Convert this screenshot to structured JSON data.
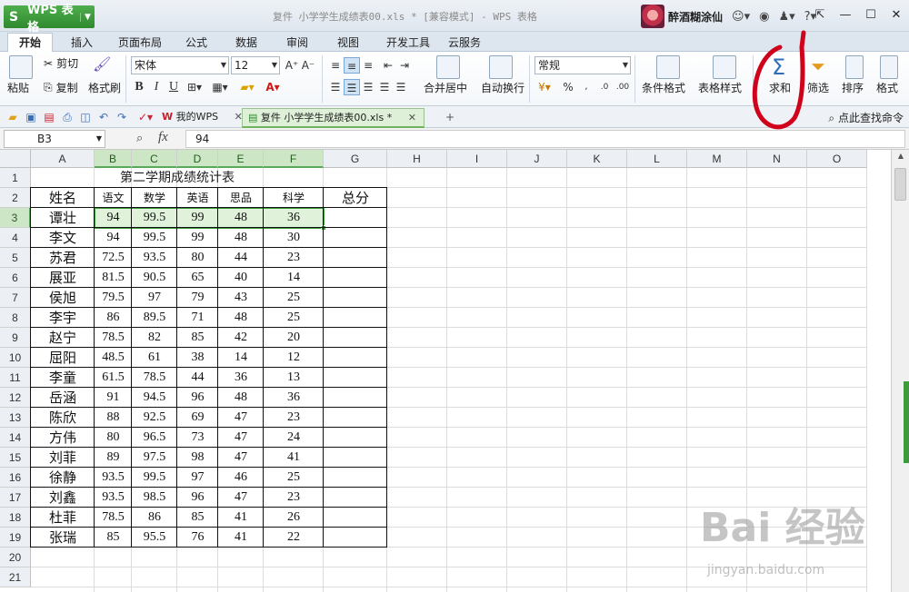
{
  "app": {
    "logo_glyph": "S",
    "name": "WPS 表格",
    "doc_title": "复件 小学学生成绩表00.xls * [兼容模式] - WPS 表格",
    "user_name": "醉酒糊涂仙",
    "window_controls": [
      "⇱",
      "—",
      "☐",
      "✕"
    ]
  },
  "menu": {
    "tabs": [
      "开始",
      "插入",
      "页面布局",
      "公式",
      "数据",
      "审阅",
      "视图",
      "开发工具",
      "云服务"
    ],
    "active": "开始"
  },
  "ribbon": {
    "paste": "粘贴",
    "cut": "剪切",
    "copy": "复制",
    "format_painter": "格式刷",
    "font_name": "宋体",
    "font_size": "12",
    "merge_center": "合并居中",
    "auto_wrap": "自动换行",
    "number_format": "常规",
    "conditional_format": "条件格式",
    "table_style": "表格样式",
    "sum": "求和",
    "filter": "筛选",
    "sort": "排序",
    "format": "格式"
  },
  "filebar": {
    "tabs": [
      {
        "label": "我的WPS"
      },
      {
        "label": "复件 小学学生成绩表00.xls *"
      }
    ],
    "search_command": "点此查找命令"
  },
  "formula": {
    "cell_ref": "B3",
    "fx": "fx",
    "value": "94"
  },
  "sheet": {
    "columns": [
      "A",
      "B",
      "C",
      "D",
      "E",
      "F",
      "G",
      "H",
      "I",
      "J",
      "K",
      "L",
      "M",
      "N",
      "O"
    ],
    "rows": [
      "1",
      "2",
      "3",
      "4",
      "5",
      "6",
      "7",
      "8",
      "9",
      "10",
      "11",
      "12",
      "13",
      "14",
      "15",
      "16",
      "17",
      "18",
      "19",
      "20",
      "21"
    ],
    "title": "第二学期成绩统计表",
    "headers": [
      "姓名",
      "语文",
      "数学",
      "英语",
      "思品",
      "科学",
      "总分"
    ],
    "data": [
      [
        "谭壮",
        "94",
        "99.5",
        "99",
        "48",
        "36"
      ],
      [
        "李文",
        "94",
        "99.5",
        "99",
        "48",
        "30"
      ],
      [
        "苏君",
        "72.5",
        "93.5",
        "80",
        "44",
        "23"
      ],
      [
        "展亚",
        "81.5",
        "90.5",
        "65",
        "40",
        "14"
      ],
      [
        "侯旭",
        "79.5",
        "97",
        "79",
        "43",
        "25"
      ],
      [
        "李宇",
        "86",
        "89.5",
        "71",
        "48",
        "25"
      ],
      [
        "赵宁",
        "78.5",
        "82",
        "85",
        "42",
        "20"
      ],
      [
        "屈阳",
        "48.5",
        "61",
        "38",
        "14",
        "12"
      ],
      [
        "李童",
        "61.5",
        "78.5",
        "44",
        "36",
        "13"
      ],
      [
        "岳涵",
        "91",
        "94.5",
        "96",
        "48",
        "36"
      ],
      [
        "陈欣",
        "88",
        "92.5",
        "69",
        "47",
        "23"
      ],
      [
        "方伟",
        "80",
        "96.5",
        "73",
        "47",
        "24"
      ],
      [
        "刘菲",
        "89",
        "97.5",
        "98",
        "47",
        "41"
      ],
      [
        "徐静",
        "93.5",
        "99.5",
        "97",
        "46",
        "25"
      ],
      [
        "刘鑫",
        "93.5",
        "98.5",
        "96",
        "47",
        "23"
      ],
      [
        "杜菲",
        "78.5",
        "86",
        "85",
        "41",
        "26"
      ],
      [
        "张瑞",
        "85",
        "95.5",
        "76",
        "41",
        "22"
      ]
    ]
  },
  "watermark": {
    "main": "Bai 经验",
    "sub": "jingyan.baidu.com"
  },
  "colors": {
    "brand_green": "#2f8a2e",
    "selection_green": "#3d9a3d",
    "annotation_red": "#d0021b"
  }
}
